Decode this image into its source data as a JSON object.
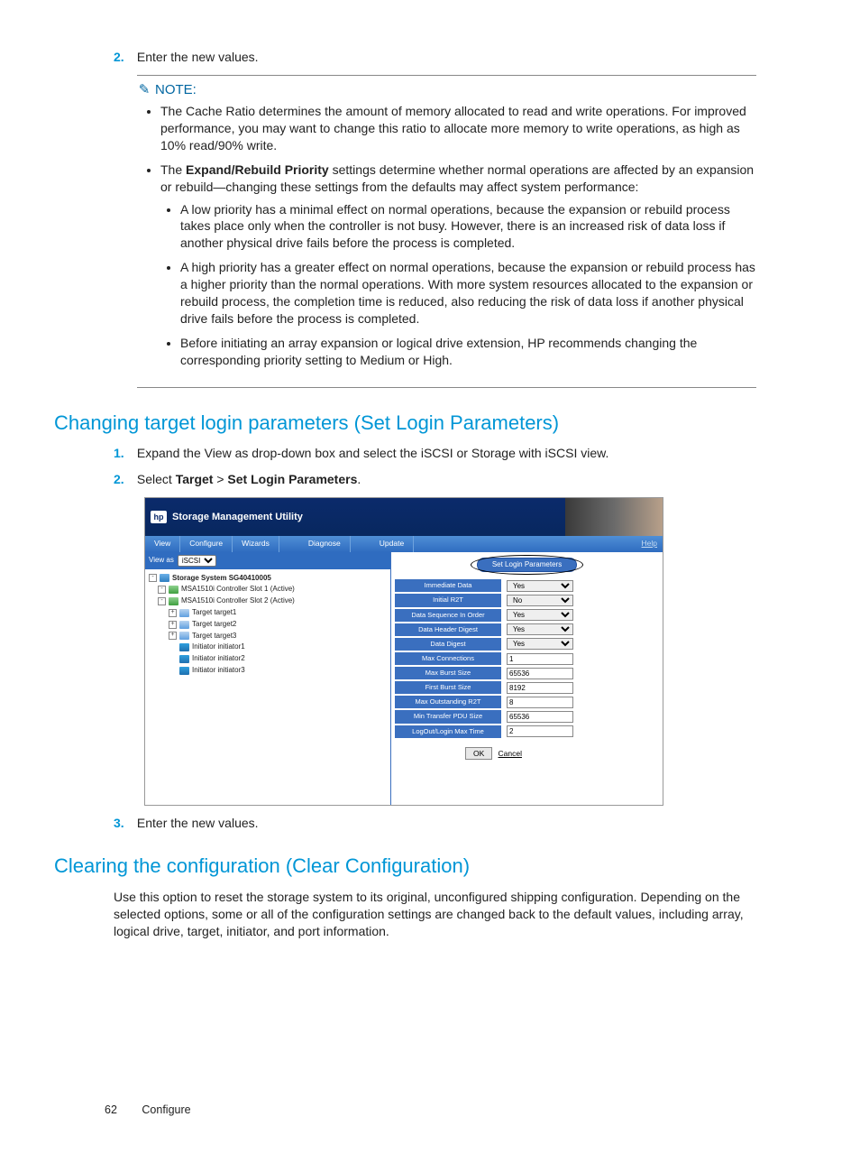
{
  "step2_top": {
    "num": "2.",
    "text": "Enter the new values."
  },
  "note": {
    "label": "NOTE:",
    "b1_a": "The Cache Ratio determines the amount of memory allocated to read and write operations. For improved performance, you may want to change this ratio to allocate more memory to write operations, as high as 10% read/90% write.",
    "b2_pre": "The ",
    "b2_bold": "Expand/Rebuild Priority",
    "b2_post": " settings determine whether normal operations are affected by an expansion or rebuild—changing these settings from the defaults may affect system performance:",
    "s1": "A low priority has a minimal effect on normal operations, because the expansion or rebuild process takes place only when the controller is not busy. However, there is an increased risk of data loss if another physical drive fails before the process is completed.",
    "s2": "A high priority has a greater effect on normal operations, because the expansion or rebuild process has a higher priority than the normal operations. With more system resources allocated to the expansion or rebuild process, the completion time is reduced, also reducing the risk of data loss if another physical drive fails before the process is completed.",
    "s3": "Before initiating an array expansion or logical drive extension, HP recommends changing the corresponding priority setting to Medium or High."
  },
  "h_login": "Changing target login parameters (Set Login Parameters)",
  "login_steps": {
    "s1": {
      "num": "1.",
      "text": "Expand the View as drop-down box and select the iSCSI or Storage with iSCSI view."
    },
    "s2": {
      "num": "2.",
      "pre": "Select ",
      "b1": "Target",
      "mid": " > ",
      "b2": "Set Login Parameters",
      "post": "."
    },
    "s3": {
      "num": "3.",
      "text": "Enter the new values."
    }
  },
  "h_clear": "Clearing the configuration (Clear Configuration)",
  "clear_para": "Use this option to reset the storage system to its original, unconfigured shipping configuration. Depending on the selected options, some or all of the configuration settings are changed back to the default values, including array, logical drive, target, initiator, and port information.",
  "footer": {
    "page": "62",
    "section": "Configure"
  },
  "smu": {
    "brand": "Storage Management Utility",
    "menu": {
      "view": "View",
      "configure": "Configure",
      "wizards": "Wizards",
      "diagnose": "Diagnose",
      "update": "Update",
      "help": "Help"
    },
    "tree": {
      "view_as": "View as",
      "view_sel": "iSCSI",
      "root": "Storage System SG40410005",
      "c1": "MSA1510i Controller Slot 1 (Active)",
      "c2": "MSA1510i Controller Slot 2 (Active)",
      "t1": "Target target1",
      "t2": "Target target2",
      "t3": "Target target3",
      "i1": "Initiator initiator1",
      "i2": "Initiator initiator2",
      "i3": "Initiator initiator3"
    },
    "form": {
      "title": "Set Login Parameters",
      "rows": [
        {
          "label": "Immediate Data",
          "type": "select",
          "value": "Yes"
        },
        {
          "label": "Initial R2T",
          "type": "select",
          "value": "No"
        },
        {
          "label": "Data Sequence In Order",
          "type": "select",
          "value": "Yes"
        },
        {
          "label": "Data Header Digest",
          "type": "select",
          "value": "Yes"
        },
        {
          "label": "Data Digest",
          "type": "select",
          "value": "Yes"
        },
        {
          "label": "Max Connections",
          "type": "input",
          "value": "1"
        },
        {
          "label": "Max Burst Size",
          "type": "input",
          "value": "65536"
        },
        {
          "label": "First Burst Size",
          "type": "input",
          "value": "8192"
        },
        {
          "label": "Max Outstanding R2T",
          "type": "input",
          "value": "8"
        },
        {
          "label": "Min Transfer PDU Size",
          "type": "input",
          "value": "65536"
        },
        {
          "label": "LogOut/Login Max Time",
          "type": "input",
          "value": "2"
        }
      ],
      "ok": "OK",
      "cancel": "Cancel"
    }
  }
}
